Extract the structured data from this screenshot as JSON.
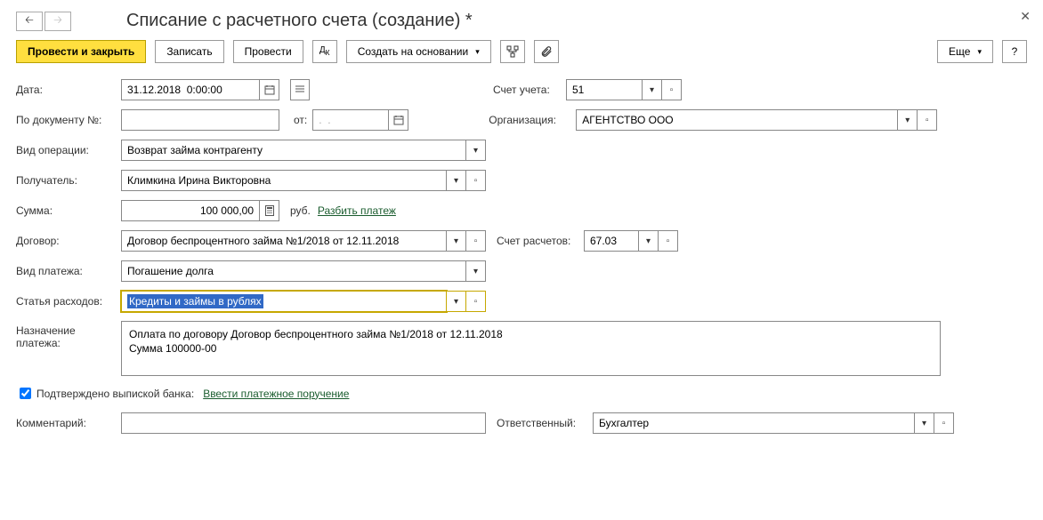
{
  "title": "Списание с расчетного счета (создание) *",
  "toolbar": {
    "postAndClose": "Провести и закрыть",
    "save": "Записать",
    "post": "Провести",
    "createBasedOn": "Создать на основании",
    "more": "Еще",
    "help": "?"
  },
  "labels": {
    "date": "Дата:",
    "docNo": "По документу №:",
    "from": "от:",
    "opType": "Вид операции:",
    "recipient": "Получатель:",
    "amount": "Сумма:",
    "contract": "Договор:",
    "paymentType": "Вид платежа:",
    "expenseItem": "Статья расходов:",
    "purpose": "Назначение платежа:",
    "confirmed": "Подтверждено выпиской банка:",
    "comment": "Комментарий:",
    "account": "Счет учета:",
    "organization": "Организация:",
    "settlementAccount": "Счет расчетов:",
    "responsible": "Ответственный:",
    "currency": "руб.",
    "splitPayment": "Разбить платеж",
    "enterPaymentOrder": "Ввести платежное поручение"
  },
  "values": {
    "date": "31.12.2018  0:00:00",
    "docNo": "",
    "docDate": ".  .",
    "opType": "Возврат займа контрагенту",
    "recipient": "Климкина Ирина Викторовна",
    "amount": "100 000,00",
    "contract": "Договор беспроцентного займа №1/2018 от 12.11.2018",
    "paymentType": "Погашение долга",
    "expenseItem": "Кредиты и займы в рублях",
    "purpose": "Оплата по договору Договор беспроцентного займа №1/2018 от 12.11.2018\nСумма 100000-00",
    "comment": "",
    "account": "51",
    "organization": "АГЕНТСТВО ООО",
    "settlementAccount": "67.03",
    "responsible": "Бухгалтер"
  }
}
